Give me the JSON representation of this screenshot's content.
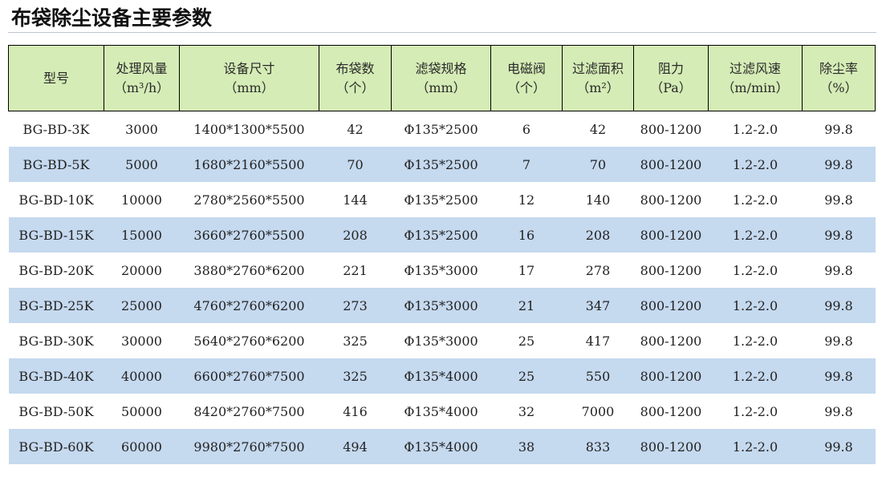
{
  "title": "布袋除尘设备主要参数",
  "colors": {
    "header_bg": "#d5ecb6",
    "stripe_bg": "#c5d9ef",
    "row_bg": "#ffffff"
  },
  "table": {
    "headers": [
      {
        "label": "型号",
        "unit": ""
      },
      {
        "label": "处理风量",
        "unit": "（m³/h）"
      },
      {
        "label": "设备尺寸",
        "unit": "（mm）"
      },
      {
        "label": "布袋数",
        "unit": "（个）"
      },
      {
        "label": "滤袋规格",
        "unit": "（mm）"
      },
      {
        "label": "电磁阀",
        "unit": "（个）"
      },
      {
        "label": "过滤面积",
        "unit": "（m²）"
      },
      {
        "label": "阻力",
        "unit": "（Pa）"
      },
      {
        "label": "过滤风速",
        "unit": "（m/min）"
      },
      {
        "label": "除尘率",
        "unit": "（%）"
      }
    ],
    "rows": [
      [
        "BG-BD-3K",
        "3000",
        "1400*1300*5500",
        "42",
        "Φ135*2500",
        "6",
        "42",
        "800-1200",
        "1.2-2.0",
        "99.8"
      ],
      [
        "BG-BD-5K",
        "5000",
        "1680*2160*5500",
        "70",
        "Φ135*2500",
        "7",
        "70",
        "800-1200",
        "1.2-2.0",
        "99.8"
      ],
      [
        "BG-BD-10K",
        "10000",
        "2780*2560*5500",
        "144",
        "Φ135*2500",
        "12",
        "140",
        "800-1200",
        "1.2-2.0",
        "99.8"
      ],
      [
        "BG-BD-15K",
        "15000",
        "3660*2760*5500",
        "208",
        "Φ135*2500",
        "16",
        "208",
        "800-1200",
        "1.2-2.0",
        "99.8"
      ],
      [
        "BG-BD-20K",
        "20000",
        "3880*2760*6200",
        "221",
        "Φ135*3000",
        "17",
        "278",
        "800-1200",
        "1.2-2.0",
        "99.8"
      ],
      [
        "BG-BD-25K",
        "25000",
        "4760*2760*6200",
        "273",
        "Φ135*3000",
        "21",
        "347",
        "800-1200",
        "1.2-2.0",
        "99.8"
      ],
      [
        "BG-BD-30K",
        "30000",
        "5640*2760*6200",
        "325",
        "Φ135*3000",
        "25",
        "417",
        "800-1200",
        "1.2-2.0",
        "99.8"
      ],
      [
        "BG-BD-40K",
        "40000",
        "6600*2760*7500",
        "325",
        "Φ135*4000",
        "25",
        "550",
        "800-1200",
        "1.2-2.0",
        "99.8"
      ],
      [
        "BG-BD-50K",
        "50000",
        "8420*2760*7500",
        "416",
        "Φ135*4000",
        "32",
        "7000",
        "800-1200",
        "1.2-2.0",
        "99.8"
      ],
      [
        "BG-BD-60K",
        "60000",
        "9980*2760*7500",
        "494",
        "Φ135*4000",
        "38",
        "833",
        "800-1200",
        "1.2-2.0",
        "99.8"
      ]
    ]
  }
}
